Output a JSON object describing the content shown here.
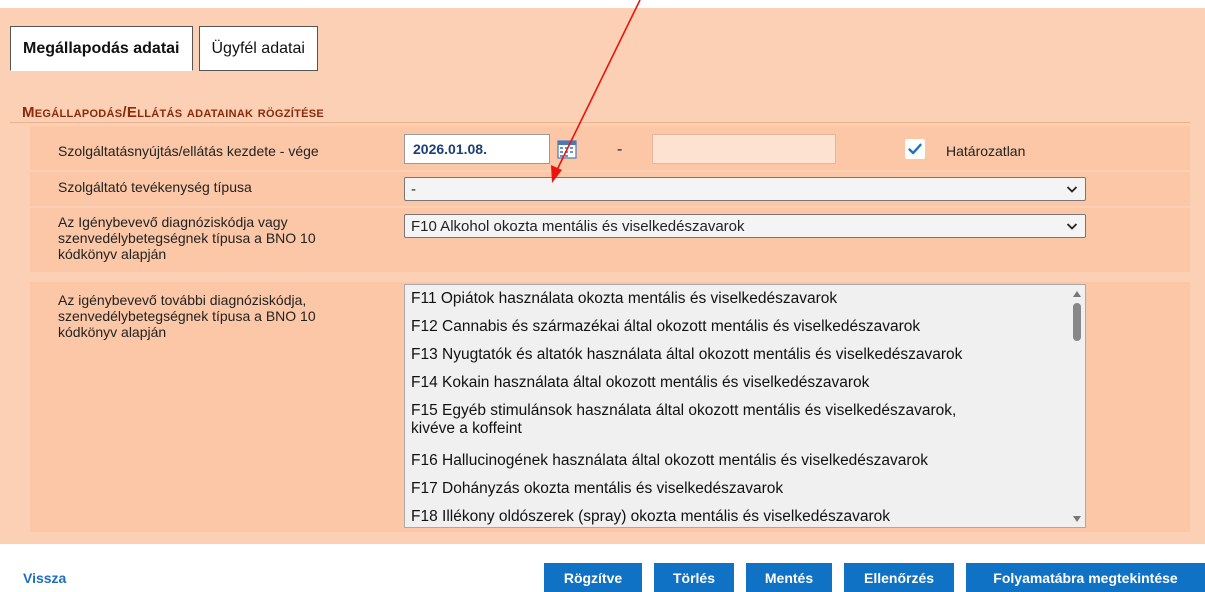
{
  "tabs": [
    {
      "label": "Megállapodás adatai",
      "active": true
    },
    {
      "label": "Ügyfél adatai",
      "active": false
    }
  ],
  "section": {
    "title": "Megállapodás/Ellátás adatainak rögzítése"
  },
  "form": {
    "service_period": {
      "label": "Szolgáltatásnyújtás/ellátás kezdete - vége",
      "start_value": "2026.01.08.",
      "separator": "-",
      "end_value": "",
      "indefinite_label": "Határozatlan",
      "indefinite_checked": true
    },
    "activity_type": {
      "label": "Szolgáltató tevékenység típusa",
      "selected": "-"
    },
    "diagnosis_code": {
      "label_lines": [
        "Az Igénybevevő diagnóziskódja vagy",
        "szenvedélybetegségnek típusa a BNO 10",
        "kódkönyv alapján"
      ],
      "selected": "F10 Alkohol okozta mentális és viselkedészavarok"
    },
    "additional_diagnosis": {
      "label_lines": [
        "Az igénybevevő további diagnóziskódja,",
        "szenvedélybetegségnek típusa a BNO 10",
        "kódkönyv alapján"
      ],
      "options": [
        [
          "F11 Opiátok használata okozta mentális és viselkedészavarok"
        ],
        [
          "F12 Cannabis és származékai által okozott mentális és viselkedészavarok"
        ],
        [
          "F13 Nyugtatók és altatók használata által okozott mentális és viselkedészavarok"
        ],
        [
          "F14 Kokain használata által okozott mentális és viselkedészavarok"
        ],
        [
          "F15 Egyéb stimulánsok használata által okozott mentális és viselkedészavarok,",
          "kivéve a koffeint"
        ],
        [
          "F16 Hallucinogének használata által okozott mentális és viselkedészavarok"
        ],
        [
          "F17 Dohányzás okozta mentális és viselkedészavarok"
        ],
        [
          "F18 Illékony oldószerek (spray) okozta mentális és viselkedészavarok"
        ]
      ]
    }
  },
  "footer": {
    "back_link": "Vissza",
    "buttons": [
      "Rögzítve",
      "Törlés",
      "Mentés",
      "Ellenőrzés",
      "Folyamatábra megtekintése"
    ]
  },
  "colors": {
    "panel": "#fbd0b5",
    "section_title": "#8b2a0a",
    "button": "#1072c4",
    "link": "#1d6fc4",
    "annotation_arrow": "#e8140e"
  },
  "icons": [
    "calendar-icon",
    "checkmark-icon",
    "chevron-down-icon"
  ]
}
